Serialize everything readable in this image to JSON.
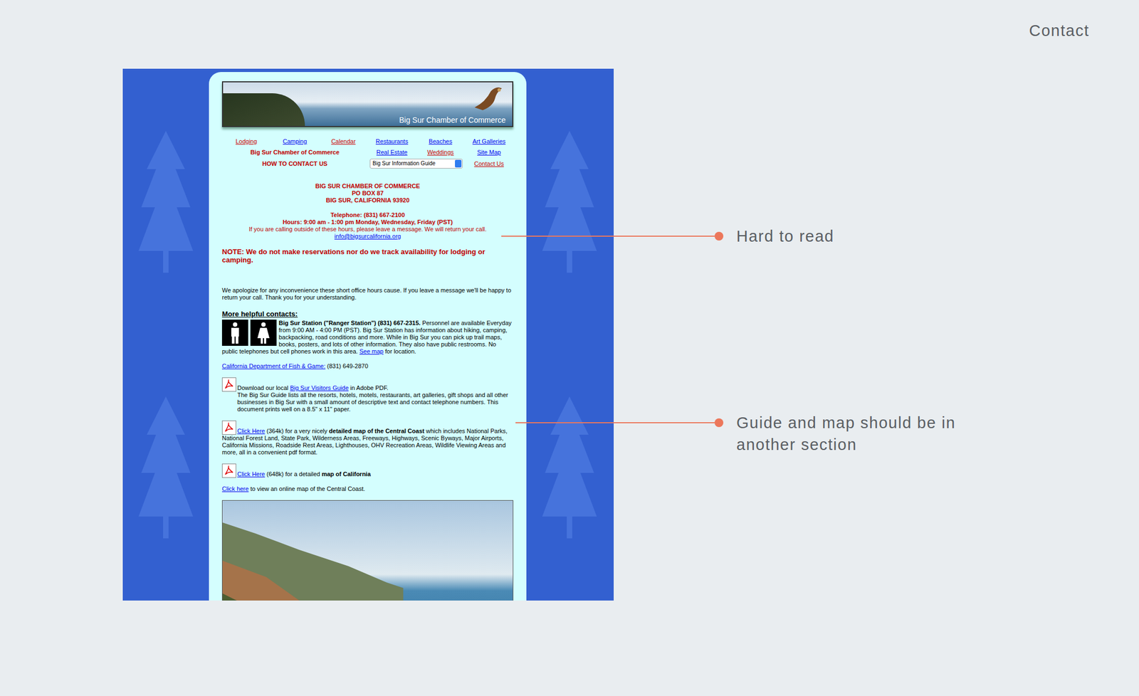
{
  "slide": {
    "title": "Contact"
  },
  "site": {
    "banner": {
      "title": "Big Sur Chamber of Commerce"
    },
    "nav": {
      "rows": [
        [
          {
            "kind": "link",
            "label": "Lodging",
            "visited": true
          },
          {
            "kind": "link",
            "label": "Camping",
            "visited": false
          },
          {
            "kind": "link",
            "label": "Calendar",
            "visited": true
          },
          {
            "kind": "link",
            "label": "Restaurants",
            "visited": false
          },
          {
            "kind": "link",
            "label": "Beaches",
            "visited": false
          },
          {
            "kind": "link",
            "label": "Art Galleries",
            "visited": false
          }
        ],
        [
          {
            "kind": "heading",
            "label": "Big Sur Chamber of Commerce"
          },
          {
            "kind": "link",
            "label": "Real Estate",
            "visited": false
          },
          {
            "kind": "link",
            "label": "Weddings",
            "visited": true
          },
          {
            "kind": "link",
            "label": "Site Map",
            "visited": false
          }
        ],
        [
          {
            "kind": "heading",
            "label": "HOW TO CONTACT US"
          },
          {
            "kind": "select",
            "label": "Big Sur Information Guide"
          },
          {
            "kind": "link",
            "label": "Contact Us",
            "visited": true
          }
        ]
      ]
    },
    "address": [
      "BIG SUR CHAMBER OF COMMERCE",
      "PO BOX 87",
      "BIG SUR, CALIFORNIA 93920"
    ],
    "telephone": "Telephone: (831) 667-2100",
    "hours": "Hours: 9:00 am - 1:00 pm Monday, Wednesday, Friday (PST)",
    "after_hours": "If you are calling outside of these hours, please leave a message. We will return your call.",
    "email": "info@bigsurcalifornia.org",
    "note": "NOTE: We do not make reservations nor do we track availability for lodging or camping.",
    "apology": "We apologize for any inconvenience these short office hours cause. If you leave a message we'll be happy to return your call. Thank you for your understanding.",
    "contacts_heading": "More helpful contacts:",
    "ranger": {
      "bold": "Big Sur Station (\"Ranger Station\") (831) 667-2315.",
      "text": " Personnel are available Everyday from 9:00 AM - 4:00 PM (PST). Big Sur Station has information about hiking, camping, backpacking, road conditions and more. While in Big Sur you can pick up trail maps, books, posters, and lots of other information. They also have public restrooms. No public telephones but cell phones work in this area. ",
      "link": "See map",
      "after": " for location."
    },
    "fish_game": {
      "link": "California Department of Fish & Game:",
      "phone": " (831) 649-2870"
    },
    "guide": {
      "before": "Download our local ",
      "link": "Big Sur Visitors Guide",
      "after": " in Adobe PDF.",
      "description": "The Big Sur Guide lists all the resorts, hotels, motels, restaurants, art galleries, gift shops and all other businesses in Big Sur with a small amount of descriptive text and contact telephone numbers. This document prints well on a 8.5\" x 11\" paper."
    },
    "central_map": {
      "link": "Click Here",
      "size": " (364k) for a very nicely ",
      "bold": "detailed map of the Central Coast",
      "after": " which includes National Parks, National Forest Land, State Park, Wilderness Areas, Freeways, Highways, Scenic Byways, Major Airports, California Missions, Roadside Rest Areas, Lighthouses, OHV Recreation Areas, Wildlife Viewing Areas and more, all in a convenient pdf format."
    },
    "california_map": {
      "link": "Click Here",
      "size": " (648k) for a detailed ",
      "bold": "map of California"
    },
    "online_map": {
      "link": "Click here",
      "after": " to view an online map of the Central Coast."
    }
  },
  "annotations": [
    {
      "text": "Hard to read"
    },
    {
      "text": "Guide and map should be in another section"
    }
  ]
}
